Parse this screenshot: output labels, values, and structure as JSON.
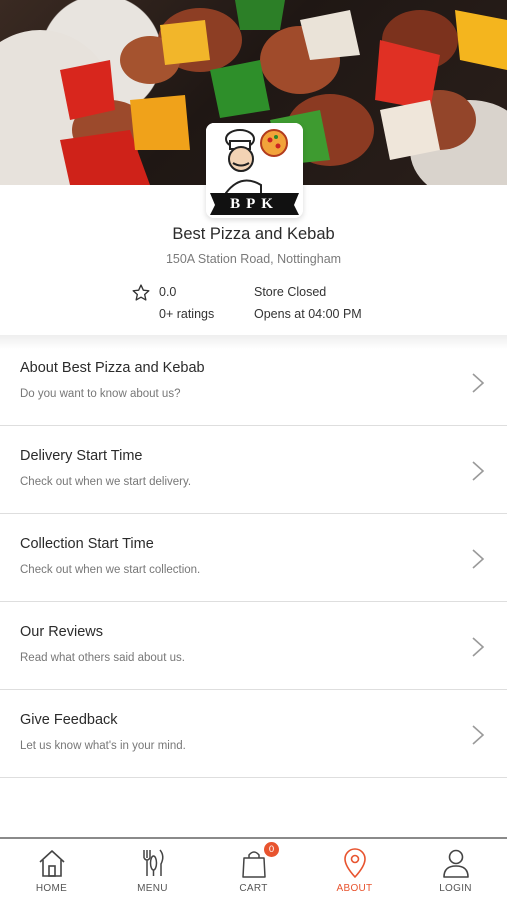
{
  "restaurant": {
    "name": "Best Pizza and Kebab",
    "address": "150A Station Road, Nottingham",
    "logo_text": "BPK"
  },
  "stats": {
    "rating": "0.0",
    "ratings_count": "0+ ratings",
    "store_status": "Store Closed",
    "opening_time": "Opens at 04:00 PM"
  },
  "list": [
    {
      "title": "About Best Pizza and Kebab",
      "subtitle": "Do you want to know about us?"
    },
    {
      "title": "Delivery Start Time",
      "subtitle": "Check out when we start delivery."
    },
    {
      "title": "Collection Start Time",
      "subtitle": "Check out when we start collection."
    },
    {
      "title": "Our Reviews",
      "subtitle": "Read what others said about us."
    },
    {
      "title": "Give Feedback",
      "subtitle": "Let us know what's in your mind."
    }
  ],
  "nav": {
    "home": "HOME",
    "menu": "MENU",
    "cart": "CART",
    "cart_count": "0",
    "about": "ABOUT",
    "login": "LOGIN",
    "active": "about"
  },
  "colors": {
    "accent": "#e8542f",
    "text": "#2b2b2b",
    "muted": "#777777"
  }
}
